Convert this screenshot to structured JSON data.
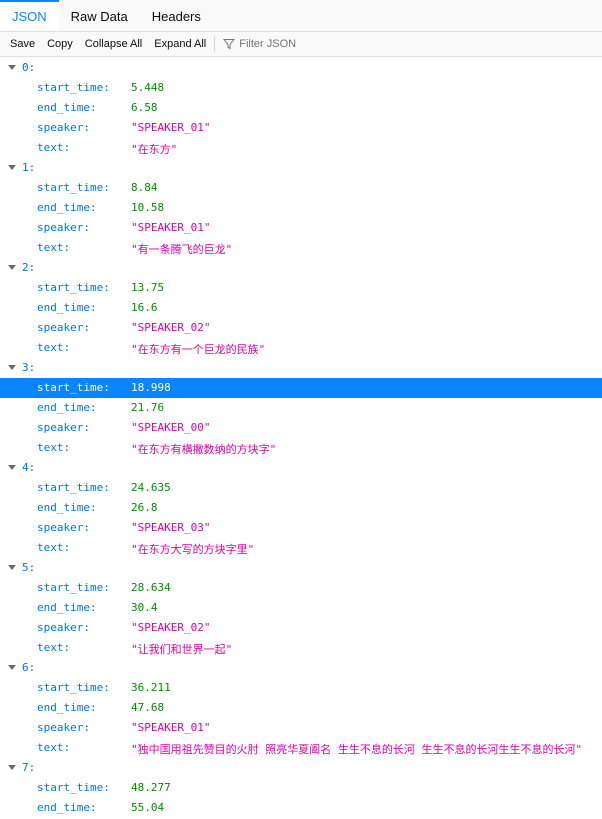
{
  "tabs": [
    {
      "label": "JSON",
      "active": true
    },
    {
      "label": "Raw Data"
    },
    {
      "label": "Headers"
    }
  ],
  "toolbar": {
    "save": "Save",
    "copy": "Copy",
    "collapse_all": "Collapse All",
    "expand_all": "Expand All",
    "filter_placeholder": "Filter JSON"
  },
  "colors": {
    "accent": "#0a84ff",
    "key": "#0074e8",
    "number": "#058b00",
    "string": "#dd00a9"
  },
  "entries": [
    {
      "index": "0:",
      "start_time": "5.448",
      "end_time": "6.58",
      "speaker": "\"SPEAKER_01\"",
      "text": "\"在东方\""
    },
    {
      "index": "1:",
      "start_time": "8.84",
      "end_time": "10.58",
      "speaker": "\"SPEAKER_01\"",
      "text": "\"有一条腾飞的巨龙\""
    },
    {
      "index": "2:",
      "start_time": "13.75",
      "end_time": "16.6",
      "speaker": "\"SPEAKER_02\"",
      "text": "\"在东方有一个巨龙的民族\""
    },
    {
      "index": "3:",
      "start_time": "18.998",
      "end_time": "21.76",
      "speaker": "\"SPEAKER_00\"",
      "text": "\"在东方有横撇数纳的方块字\""
    },
    {
      "index": "4:",
      "start_time": "24.635",
      "end_time": "26.8",
      "speaker": "\"SPEAKER_03\"",
      "text": "\"在东方大写的方块字里\""
    },
    {
      "index": "5:",
      "start_time": "28.634",
      "end_time": "30.4",
      "speaker": "\"SPEAKER_02\"",
      "text": "\"让我们和世界一起\""
    },
    {
      "index": "6:",
      "start_time": "36.211",
      "end_time": "47.68",
      "speaker": "\"SPEAKER_01\"",
      "text": "\"独中国用祖先赞目的火肘 照亮华夏阖名 生生不息的长河 生生不息的长河生生不息的长河\""
    },
    {
      "index": "7:",
      "start_time": "48.277",
      "end_time": "55.04"
    }
  ]
}
